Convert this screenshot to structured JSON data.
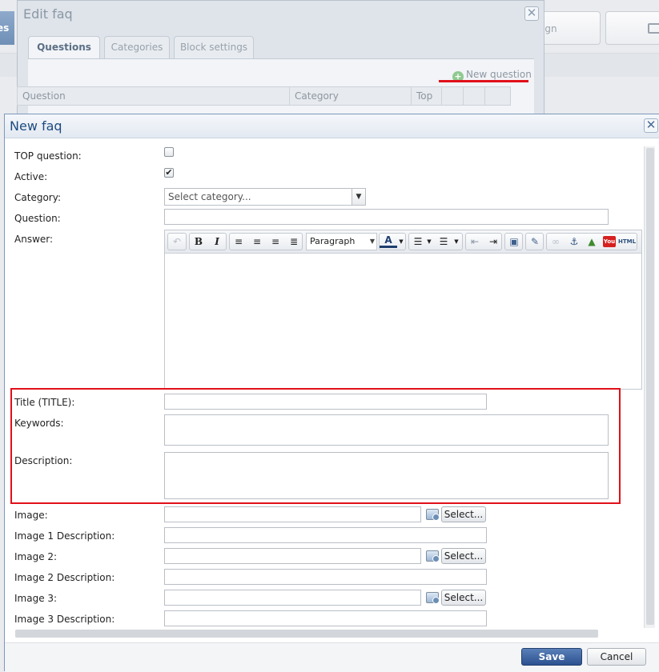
{
  "background": {
    "left_button_label": "es",
    "design_button_label": "ign"
  },
  "edit_faq": {
    "title": "Edit faq",
    "tabs": [
      "Questions",
      "Categories",
      "Block settings"
    ],
    "new_question_label": "New question",
    "grid_columns": [
      "Question",
      "Category",
      "Top",
      "",
      "",
      ""
    ]
  },
  "new_faq": {
    "title": "New faq",
    "close_glyph": "✕",
    "labels": {
      "top_question": "TOP question:",
      "active": "Active:",
      "category": "Category:",
      "question": "Question:",
      "answer": "Answer:",
      "title": "Title (TITLE):",
      "keywords": "Keywords:",
      "description": "Description:",
      "image": "Image:",
      "image1_desc": "Image 1 Description:",
      "image2": "Image 2:",
      "image2_desc": "Image 2 Description:",
      "image3": "Image 3:",
      "image3_desc": "Image 3 Description:"
    },
    "top_question_checked": false,
    "active_checked": true,
    "category_placeholder": "Select category...",
    "editor": {
      "format_value": "Paragraph",
      "bold_glyph": "B",
      "italic_glyph": "I",
      "html_label": "HTML",
      "youtube_label": "You"
    },
    "select_button_label": "Select...",
    "save_label": "Save",
    "cancel_label": "Cancel"
  },
  "colors": {
    "highlight": "#e0101a",
    "dialog_title": "#1e4b80",
    "save_button": "#2c5190"
  }
}
